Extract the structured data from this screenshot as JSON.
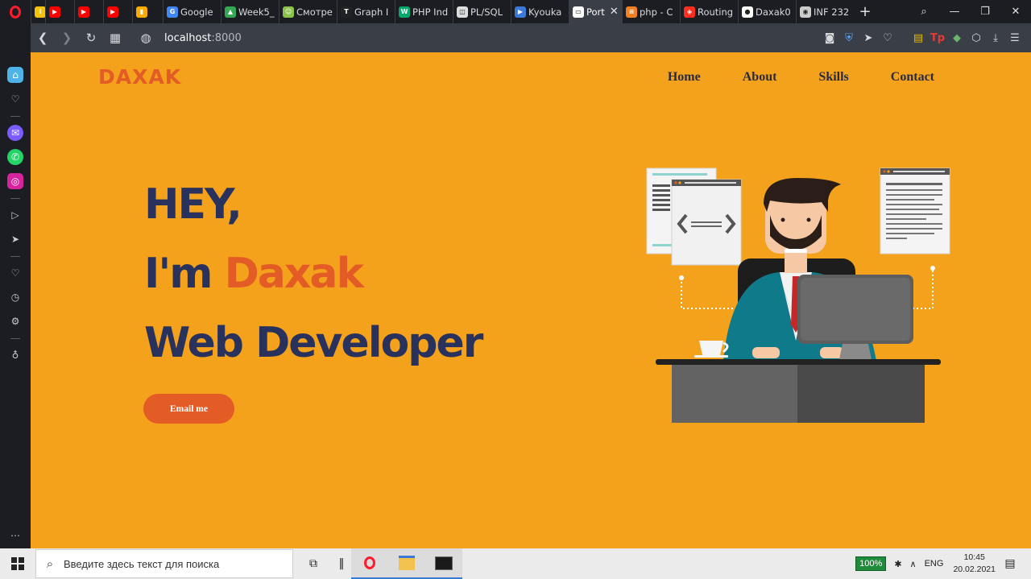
{
  "tabs": [
    {
      "label": "",
      "icon": "info-icon",
      "color": "#f4c20d",
      "active": false
    },
    {
      "label": "",
      "icon": "youtube-icon",
      "color": "#ff0000",
      "active": false
    },
    {
      "label": "",
      "icon": "youtube-icon",
      "color": "#ff0000",
      "active": false
    },
    {
      "label": "",
      "icon": "youtube-icon",
      "color": "#ff0000",
      "active": false
    },
    {
      "label": "",
      "icon": "analytics-icon",
      "color": "#f9ab00",
      "active": false
    },
    {
      "label": "Google",
      "icon": "google-translate-icon",
      "color": "#4285f4",
      "active": false
    },
    {
      "label": "Week5_",
      "icon": "google-drive-icon",
      "color": "#34a853",
      "active": false
    },
    {
      "label": "Смотре",
      "icon": "anime-site-icon",
      "color": "#8bc34a",
      "active": false
    },
    {
      "label": "Graph I",
      "icon": "tutorial-icon",
      "color": "#222222",
      "active": false
    },
    {
      "label": "PHP Ind",
      "icon": "w3-icon",
      "color": "#04aa6d",
      "active": false
    },
    {
      "label": "PL/SQL",
      "icon": "database-icon",
      "color": "#dddddd",
      "active": false
    },
    {
      "label": "Kyouka",
      "icon": "video-icon",
      "color": "#3b78d8",
      "active": false
    },
    {
      "label": "Port",
      "icon": "document-icon",
      "color": "#ffffff",
      "active": true
    },
    {
      "label": "php - C",
      "icon": "stackoverflow-icon",
      "color": "#f48024",
      "active": false
    },
    {
      "label": "Routing",
      "icon": "laravel-icon",
      "color": "#ff2d20",
      "active": false
    },
    {
      "label": "Daxak0",
      "icon": "github-icon",
      "color": "#ffffff",
      "active": false
    },
    {
      "label": "INF 232",
      "icon": "university-icon",
      "color": "#cccccc",
      "active": false
    }
  ],
  "address": {
    "host": "localhost",
    "port": ":8000"
  },
  "site": {
    "logo": "DAXAK",
    "nav": [
      "Home",
      "About",
      "Skills",
      "Contact"
    ],
    "hero": {
      "line1": "HEY,",
      "line2_prefix": "I'm ",
      "line2_accent": "Daxak",
      "line3": "Web Developer"
    },
    "button": "Email me",
    "colors": {
      "background": "#f4a21c",
      "accent": "#e35b25",
      "heading": "#28325c"
    }
  },
  "taskbar": {
    "search_placeholder": "Введите здесь текст для поиска",
    "battery": "100%",
    "language": "ENG",
    "time": "10:45",
    "date": "20.02.2021"
  }
}
